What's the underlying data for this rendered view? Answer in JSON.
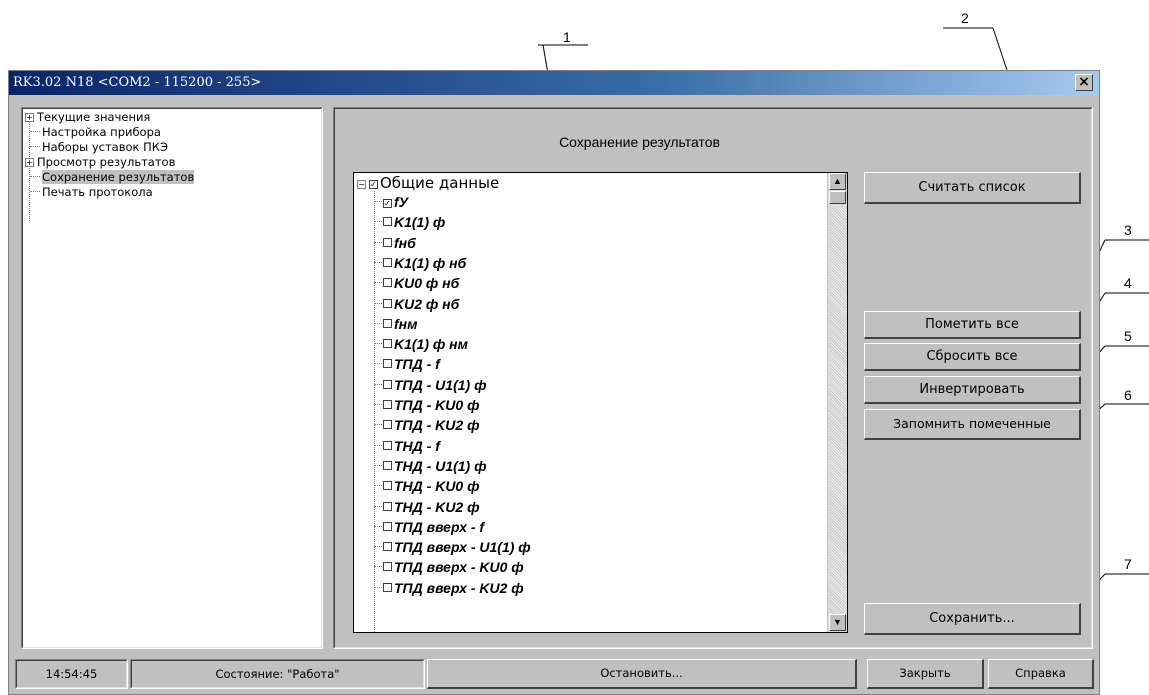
{
  "window": {
    "title": "RK3.02 N18 <COM2 - 115200 - 255>",
    "close_glyph": "×"
  },
  "nav": {
    "items": [
      {
        "label": "Текущие значения",
        "expander": "+"
      },
      {
        "label": "Настройка прибора",
        "expander": ""
      },
      {
        "label": "Наборы уставок ПКЭ",
        "expander": ""
      },
      {
        "label": "Просмотр результатов",
        "expander": "+"
      },
      {
        "label": "Сохранение результатов",
        "expander": "",
        "selected": true
      },
      {
        "label": "Печать протокола",
        "expander": ""
      }
    ]
  },
  "main": {
    "title": "Сохранение результатов"
  },
  "checklist": {
    "root": {
      "label": "Общие данные",
      "expander": "−",
      "checked": true
    },
    "items": [
      {
        "label": "fУ",
        "checked": true
      },
      {
        "label": "K1(1) ф",
        "checked": false
      },
      {
        "label": "fнб",
        "checked": false
      },
      {
        "label": "K1(1) ф нб",
        "checked": false
      },
      {
        "label": "KU0 ф нб",
        "checked": false
      },
      {
        "label": "KU2 ф нб",
        "checked": false
      },
      {
        "label": "fнм",
        "checked": false
      },
      {
        "label": "K1(1) ф нм",
        "checked": false
      },
      {
        "label": "TПД - f",
        "checked": false
      },
      {
        "label": "TПД - U1(1) ф",
        "checked": false
      },
      {
        "label": "TПД - KU0 ф",
        "checked": false
      },
      {
        "label": "TПД - KU2 ф",
        "checked": false
      },
      {
        "label": "TНД - f",
        "checked": false
      },
      {
        "label": "TНД - U1(1) ф",
        "checked": false
      },
      {
        "label": "TНД - KU0 ф",
        "checked": false
      },
      {
        "label": "TНД - KU2 ф",
        "checked": false
      },
      {
        "label": "TПД вверх - f",
        "checked": false
      },
      {
        "label": "TПД вверх - U1(1) ф",
        "checked": false
      },
      {
        "label": "TПД вверх - KU0 ф",
        "checked": false
      },
      {
        "label": "TПД вверх - KU2 ф",
        "checked": false
      }
    ],
    "scroll_up_glyph": "▲",
    "scroll_down_glyph": "▼"
  },
  "buttons": {
    "read_list": "Считать список",
    "mark_all": "Пометить все",
    "reset_all": "Сбросить все",
    "invert": "Инвертировать",
    "remember_marked": "Запомнить помеченные",
    "save": "Сохранить..."
  },
  "status": {
    "time": "14:54:45",
    "state": "Состояние: \"Работа\"",
    "stop": "Остановить...",
    "close": "Закрыть",
    "help": "Справка"
  },
  "callouts": [
    "1",
    "2",
    "3",
    "4",
    "5",
    "6",
    "7"
  ],
  "colors": {
    "titlebar_start": "#0a246a",
    "titlebar_end": "#a6caf0",
    "face": "#c0c0c0"
  }
}
